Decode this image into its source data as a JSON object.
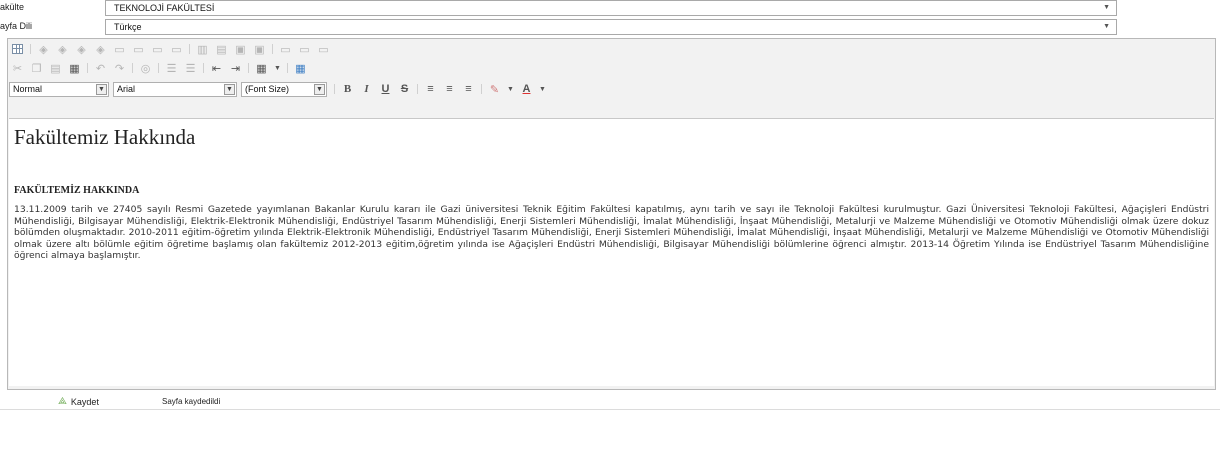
{
  "form": {
    "faculty_label": "akülte",
    "faculty_value": "TEKNOLOJİ FAKÜLTESİ",
    "language_label": "ayfa Dili",
    "language_value": "Türkçe"
  },
  "editor": {
    "format_combo": "Normal",
    "font_combo": "Arial",
    "size_combo": "(Font Size)",
    "bold": "B",
    "italic": "I",
    "underline": "U",
    "strike": "S",
    "font_color": "A"
  },
  "content": {
    "title": "Fakültemiz Hakkında",
    "subheading": "FAKÜLTEMİZ HAKKINDA",
    "body": "13.11.2009 tarih ve 27405 sayılı Resmi Gazetede yayımlanan Bakanlar Kurulu kararı ile Gazi üniversitesi Teknik Eğitim Fakültesi kapatılmış, aynı tarih ve sayı ile Teknoloji Fakültesi kurulmuştur.  Gazi Üniversitesi Teknoloji Fakültesi, Ağaçişleri Endüstri Mühendisliği, Bilgisayar Mühendisliği, Elektrik-Elektronik Mühendisliği, Endüstriyel Tasarım Mühendisliği, Enerji Sistemleri Mühendisliği, İmalat Mühendisliği, İnşaat Mühendisliği, Metalurji ve Malzeme Mühendisliği ve Otomotiv Mühendisliği olmak üzere dokuz bölümden oluşmaktadır. 2010-2011 eğitim-öğretim yılında Elektrik-Elektronik Mühendisliği, Endüstriyel Tasarım Mühendisliği, Enerji Sistemleri Mühendisliği, İmalat Mühendisliği, İnşaat Mühendisliği, Metalurji ve Malzeme Mühendisliği ve Otomotiv Mühendisliği olmak üzere altı bölümle eğitim öğretime başlamış olan fakültemiz 2012-2013 eğitim,öğretim yılında ise Ağaçişleri Endüstri Mühendisliği, Bilgisayar Mühendisliği bölümlerine öğrenci almıştır. 2013-14 Öğretim Yılında ise Endüstriyel Tasarım Mühendisliğine öğrenci almaya başlamıştır."
  },
  "footer": {
    "save_label": "Kaydet",
    "status_text": "Sayfa kaydedildi"
  }
}
